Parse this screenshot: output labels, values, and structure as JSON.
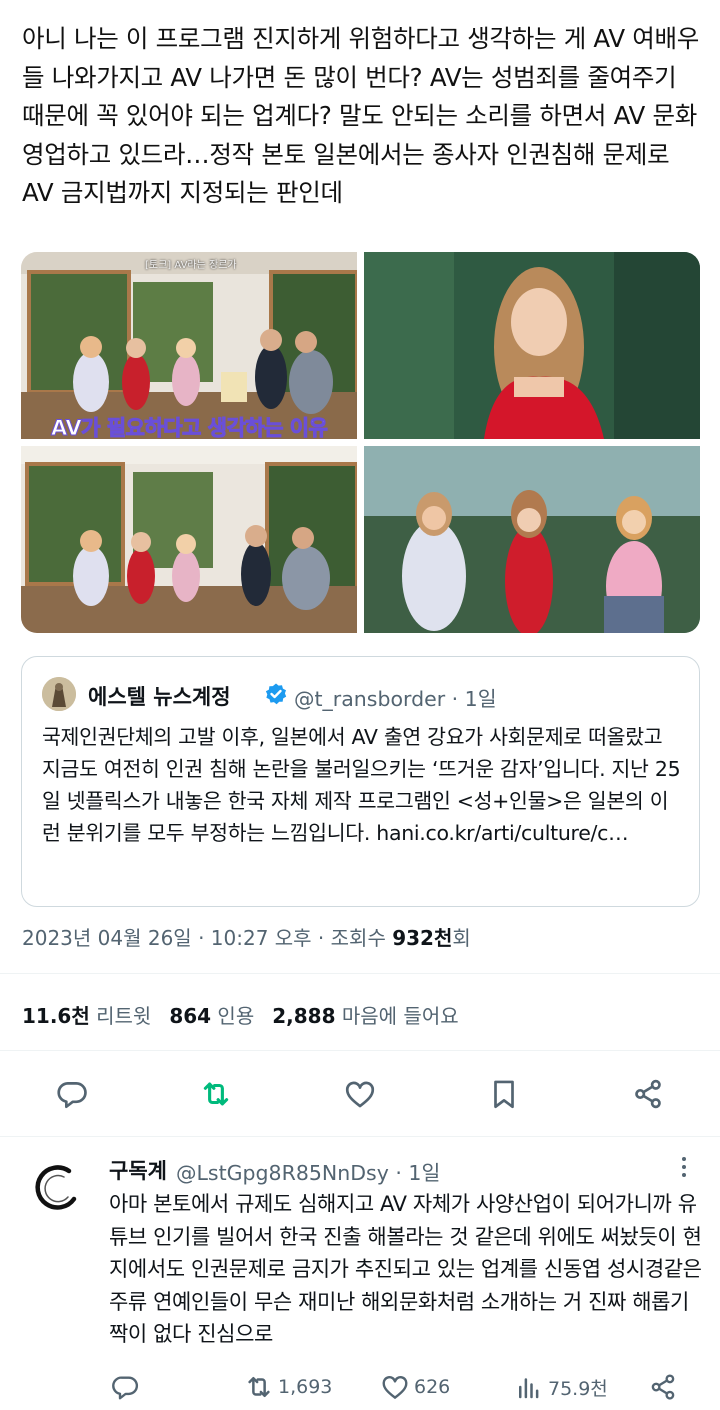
{
  "tweet": {
    "text": "아니 나는 이 프로그램 진지하게 위험하다고 생각하는 게 AV 여배우들 나와가지고 AV 나가면 돈 많이 번다? AV는 성범죄를 줄여주기 때문에 꼭 있어야 되는 업계다? 말도 안되는 소리를 하면서 AV 문화 영업하고 있드라…정작 본토 일본에서는 종사자 인권침해 문제로 AV 금지법까지 지정되는 판인데"
  },
  "media": {
    "tile1_caption": "[토크] AV라는 장르가",
    "tile1_subtitle": "AV가 필요하다고 생각하는 이유"
  },
  "quote": {
    "name": "에스텔 뉴스계정",
    "handle": "@t_ransborder · 1일",
    "body": "국제인권단체의 고발 이후, 일본에서 AV 출연 강요가 사회문제로 떠올랐고 지금도 여전히 인권 침해 논란을 불러일으키는 ‘뜨거운 감자’입니다. 지난 25일 넷플릭스가 내놓은 한국 자체 제작 프로그램인 <성+인물>은 일본의 이런 분위기를 모두 부정하는 느낌입니다. hani.co.kr/arti/culture/c…"
  },
  "meta": {
    "timestamp": "2023년 04월 26일 · 10:27 오후 · 조회수 ",
    "views": "932천",
    "views_suffix": "회"
  },
  "stats": {
    "retweets_count": "11.6천",
    "retweets_label": " 리트윗",
    "quotes_count": "864",
    "quotes_label": " 인용",
    "likes_count": "2,888",
    "likes_label": " 마음에 들어요"
  },
  "colors": {
    "retweet_green": "#00ba7c",
    "icon_gray": "#536471",
    "verified_blue": "#1d9bf0"
  },
  "reply": {
    "name": "구독계",
    "handle": "@LstGpg8R85NnDsy · 1일",
    "body": "아마 본토에서 규제도 심해지고 AV 자체가 사양산업이 되어가니까 유튜브 인기를 빌어서 한국 진출 해볼라는 것 같은데 위에도 써놨듯이 현지에서도 인권문제로 금지가 추진되고 있는 업계를 신동엽 성시경같은 주류 연예인들이 무슨 재미난 해외문화처럼 소개하는 거 진짜 해롭기 짝이 없다 진심으로",
    "retweets": "1,693",
    "likes": "626",
    "views": "75.9천"
  }
}
